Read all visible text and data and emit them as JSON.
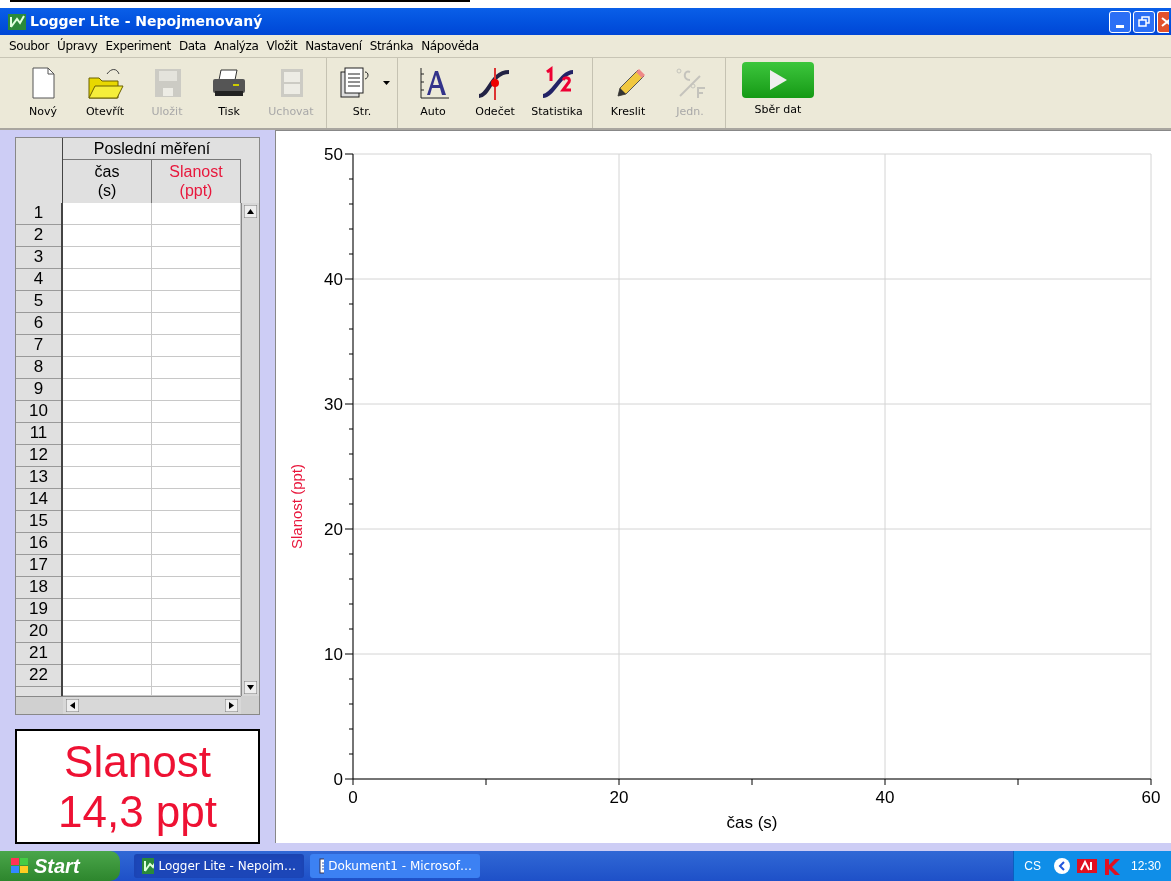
{
  "window": {
    "title": "Logger Lite - Nepojmenovaný"
  },
  "menu": [
    "Soubor",
    "Úpravy",
    "Experiment",
    "Data",
    "Analýza",
    "Vložit",
    "Nastavení",
    "Stránka",
    "Nápověda"
  ],
  "toolbar": {
    "groups": [
      {
        "buttons": [
          {
            "label": "Nový",
            "kind": "new",
            "disabled": false
          },
          {
            "label": "Otevřít",
            "kind": "open",
            "disabled": false
          },
          {
            "label": "Uložit",
            "kind": "save",
            "disabled": true
          },
          {
            "label": "Tisk",
            "kind": "print",
            "disabled": false
          },
          {
            "label": "Uchovat",
            "kind": "store",
            "disabled": true
          }
        ]
      },
      {
        "buttons": [
          {
            "label": "Str.",
            "kind": "pages",
            "disabled": false,
            "dropdown": true
          }
        ]
      },
      {
        "buttons": [
          {
            "label": "Auto",
            "kind": "autoscale",
            "disabled": false
          },
          {
            "label": "Odečet",
            "kind": "examine",
            "disabled": false
          },
          {
            "label": "Statistika",
            "kind": "stats",
            "disabled": false
          }
        ]
      },
      {
        "buttons": [
          {
            "label": "Kreslit",
            "kind": "pencil",
            "disabled": false
          },
          {
            "label": "Jedn.",
            "kind": "units",
            "disabled": true
          }
        ]
      },
      {
        "buttons": [
          {
            "label": "Sběr dat",
            "kind": "collect",
            "disabled": false
          }
        ]
      }
    ]
  },
  "table": {
    "group_header": "Poslední měření",
    "columns": [
      {
        "name": "čas",
        "unit": "(s)",
        "color": "#000000"
      },
      {
        "name": "Slanost",
        "unit": "(ppt)",
        "color": "#e8173c"
      }
    ],
    "row_numbers": [
      "1",
      "2",
      "3",
      "4",
      "5",
      "6",
      "7",
      "8",
      "9",
      "10",
      "11",
      "12",
      "13",
      "14",
      "15",
      "16",
      "17",
      "18",
      "19",
      "20",
      "21",
      "22"
    ]
  },
  "meter": {
    "name": "Slanost",
    "reading": "14,3 ppt"
  },
  "graph": {
    "chart_data": {
      "type": "line",
      "xlabel": "čas (s)",
      "ylabel": "Slanost (ppt)",
      "xlim": [
        0,
        60
      ],
      "ylim": [
        0,
        50
      ],
      "xticks": [
        0,
        20,
        40,
        60
      ],
      "yticks": [
        0,
        10,
        20,
        30,
        40,
        50
      ],
      "grid": true
    }
  },
  "taskbar": {
    "start": "Start",
    "tasks": [
      {
        "label": "Logger Lite - Nepojm…",
        "kind": "logger",
        "selected": true
      },
      {
        "label": "Dokument1 - Microsof…",
        "kind": "word",
        "selected": false
      }
    ],
    "language": "CS",
    "clock": "12:30"
  }
}
